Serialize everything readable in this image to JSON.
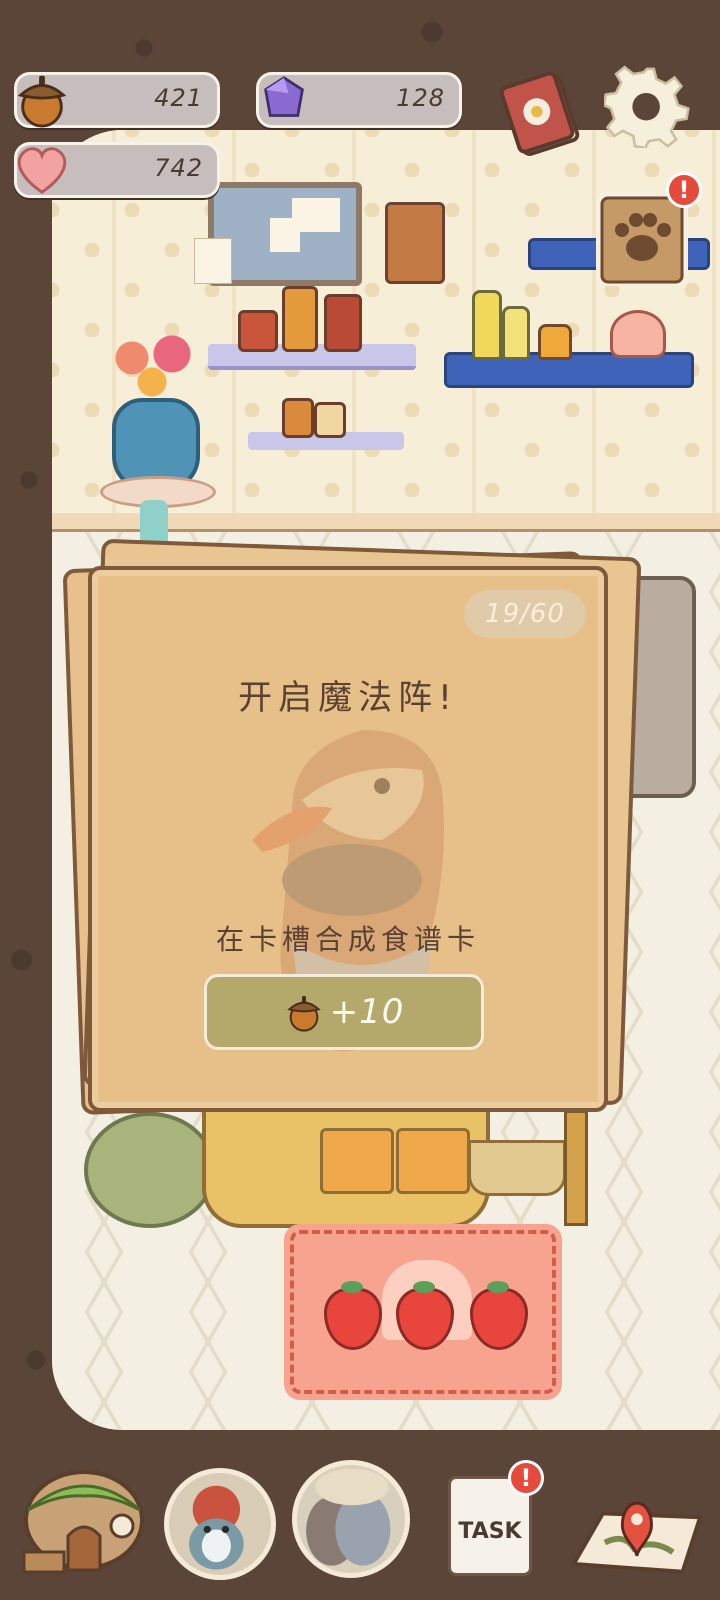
{
  "hud": {
    "acorns": "421",
    "crystals": "128",
    "hearts": "742",
    "book_icon": "recipe-book-icon",
    "settings_icon": "gear-icon",
    "paw_icon": "paw-note-icon",
    "paw_badge": "!"
  },
  "card": {
    "progress": "19/60",
    "title": "开启魔法阵!",
    "description": "在卡槽合成食谱卡",
    "reward": "+10",
    "reward_icon": "acorn-icon"
  },
  "nav": {
    "home_icon": "house-icon",
    "penguin_icon": "penguin-avatar-icon",
    "birds_icon": "birds-avatar-icon",
    "task_label": "TASK",
    "task_badge": "!",
    "map_icon": "map-icon"
  },
  "colors": {
    "frame": "#5a4538",
    "card": "#e7bf88",
    "reward_button": "#b5a86b",
    "badge": "#e64a3c"
  }
}
